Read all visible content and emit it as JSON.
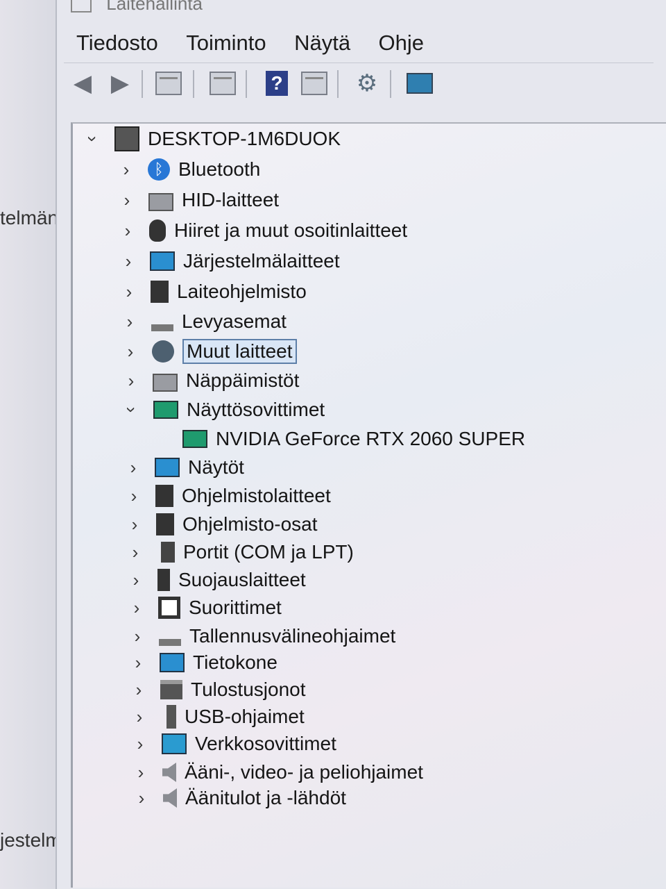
{
  "background_window": {
    "text_1": "telmän",
    "text_2": "jestelmän"
  },
  "window": {
    "title": "Laitehallinta"
  },
  "menu": [
    "Tiedosto",
    "Toiminto",
    "Näytä",
    "Ohje"
  ],
  "toolbar": {
    "icons": [
      "back-arrow-icon",
      "forward-arrow-icon",
      "properties-icon",
      "update-driver-icon",
      "help-icon",
      "view-icon",
      "scan-hardware-icon",
      "computer-monitor-icon"
    ]
  },
  "tree": {
    "root": "DESKTOP-1M6DUOK",
    "items": [
      {
        "label": "Bluetooth",
        "icon": "bluetooth-icon"
      },
      {
        "label": "HID-laitteet",
        "icon": "hid-icon"
      },
      {
        "label": "Hiiret ja muut osoitinlaitteet",
        "icon": "mouse-icon"
      },
      {
        "label": "Järjestelmälaitteet",
        "icon": "system-devices-icon"
      },
      {
        "label": "Laiteohjelmisto",
        "icon": "firmware-icon"
      },
      {
        "label": "Levyasemat",
        "icon": "disk-drive-icon"
      },
      {
        "label": "Muut laitteet",
        "icon": "other-devices-icon",
        "selected": true
      },
      {
        "label": "Näppäimistöt",
        "icon": "keyboard-icon"
      },
      {
        "label": "Näyttösovittimet",
        "icon": "display-adapter-icon",
        "expanded": true
      },
      {
        "label": "NVIDIA GeForce RTX 2060 SUPER",
        "icon": "gpu-icon",
        "child": true
      },
      {
        "label": "Näytöt",
        "icon": "monitor-icon"
      },
      {
        "label": "Ohjelmistolaitteet",
        "icon": "software-device-icon"
      },
      {
        "label": "Ohjelmisto-osat",
        "icon": "software-component-icon"
      },
      {
        "label": "Portit (COM ja LPT)",
        "icon": "port-icon"
      },
      {
        "label": "Suojauslaitteet",
        "icon": "security-device-icon"
      },
      {
        "label": "Suorittimet",
        "icon": "processor-icon"
      },
      {
        "label": "Tallennusvälineohjaimet",
        "icon": "storage-controller-icon"
      },
      {
        "label": "Tietokone",
        "icon": "computer-icon"
      },
      {
        "label": "Tulostusjonot",
        "icon": "print-queue-icon"
      },
      {
        "label": "USB-ohjaimet",
        "icon": "usb-icon"
      },
      {
        "label": "Verkkosovittimet",
        "icon": "network-adapter-icon"
      },
      {
        "label": "Ääni-, video- ja peliohjaimet",
        "icon": "sound-icon"
      },
      {
        "label": "Äänitulot ja -lähdöt",
        "icon": "audio-io-icon"
      }
    ]
  }
}
